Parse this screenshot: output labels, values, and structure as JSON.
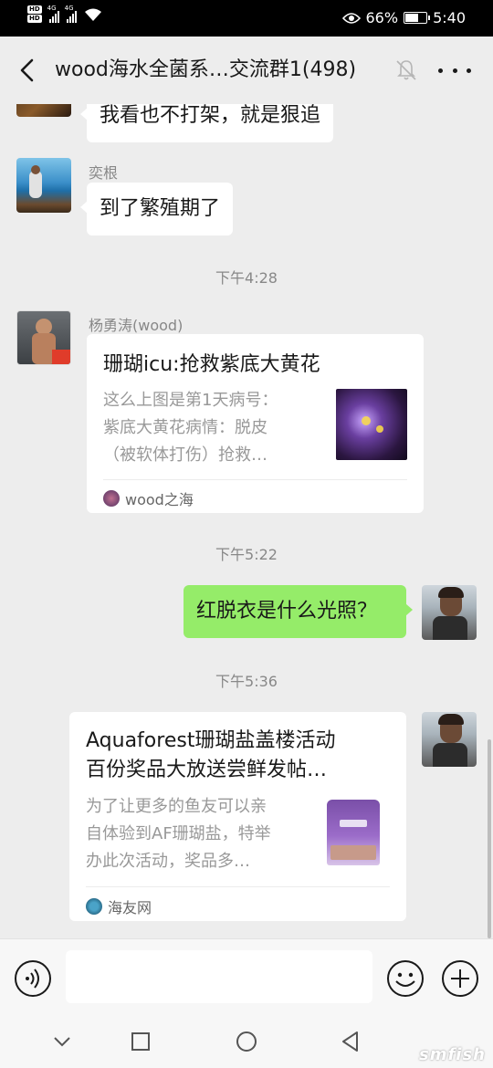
{
  "status_bar": {
    "hd1": "HD",
    "hd2": "HD",
    "net1": "4G",
    "net2": "4G",
    "battery_pct": "66%",
    "battery_level": 0.66,
    "time": "5:40"
  },
  "header": {
    "title": "wood海水全菌系…交流群1(498)"
  },
  "messages": [
    {
      "text": "我看也不打架，就是狠追"
    },
    {
      "sender": "奕根",
      "text": "到了繁殖期了"
    },
    {
      "time": "下午4:28"
    },
    {
      "sender": "杨勇涛(wood)",
      "card": {
        "title": "珊瑚icu:抢救紫底大黄花",
        "desc_lines": [
          "这么上图是第1天病号：",
          "紫底大黄花病情：脱皮",
          "（被软体打伤）抢救…"
        ],
        "source": "wood之海"
      }
    },
    {
      "time": "下午5:22"
    },
    {
      "text": "红脱衣是什么光照？"
    },
    {
      "time": "下午5:36"
    },
    {
      "card": {
        "title_lines": [
          "Aquaforest珊瑚盐盖楼活动",
          "百份奖品大放送尝鲜发帖…"
        ],
        "desc_lines": [
          "为了让更多的鱼友可以亲",
          "自体验到AF珊瑚盐，特举",
          "办此次活动，奖品多…"
        ],
        "source": "海友网"
      }
    }
  ],
  "icons": {
    "back": "back-arrow-icon",
    "mute": "bell-off-icon",
    "more": "more-dots-icon",
    "voice": "voice-icon",
    "emoji": "emoji-icon",
    "plus": "plus-icon"
  },
  "colors": {
    "outgoing_bubble": "#95ec69",
    "incoming_bubble": "#ffffff",
    "background": "#ededed"
  },
  "watermark": "smfish"
}
